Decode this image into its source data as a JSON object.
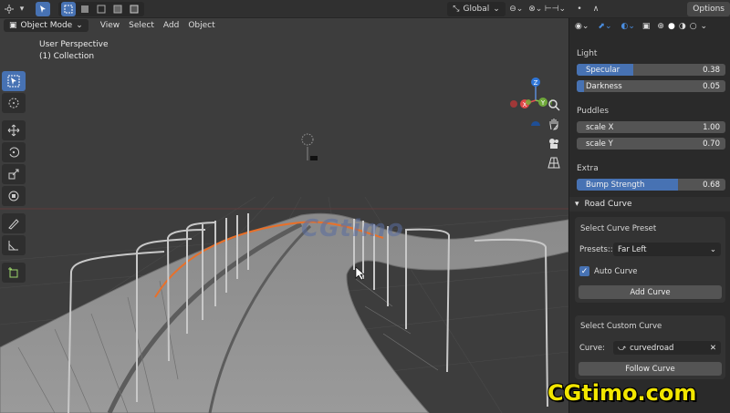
{
  "topbar": {
    "orientation": "Global",
    "options_label": "Options"
  },
  "header": {
    "mode": "Object Mode",
    "menus": [
      "View",
      "Select",
      "Add",
      "Object"
    ]
  },
  "viewport": {
    "view_name": "User Perspective",
    "collection": "(1) Collection",
    "logo_text": "CGtimo",
    "gizmo": {
      "z": "Z",
      "y": "Y",
      "x": "X"
    }
  },
  "panel": {
    "light": {
      "title": "Light",
      "specular_label": "Specular",
      "specular_value": "0.38",
      "specular": 0.38,
      "darkness_label": "Darkness",
      "darkness_value": "0.05",
      "darkness": 0.05
    },
    "puddles": {
      "title": "Puddles",
      "scalex_label": "scale X",
      "scalex_value": "1.00",
      "scaley_label": "scale Y",
      "scaley_value": "0.70"
    },
    "extra": {
      "title": "Extra",
      "bump_label": "Bump Strength",
      "bump_value": "0.68",
      "bump": 0.68
    },
    "road_curve": {
      "title": "Road Curve",
      "preset_title": "Select Curve Preset",
      "presets_label": "Presets::",
      "presets_value": "Far Left",
      "auto_curve_label": "Auto Curve",
      "add_curve_label": "Add Curve",
      "custom_title": "Select Custom Curve",
      "curve_label": "Curve:",
      "curve_value": "curvedroad",
      "follow_curve_label": "Follow Curve"
    }
  },
  "watermark": "CGtimo.com",
  "colors": {
    "accent": "#4772b3",
    "panel": "#2a2a2a",
    "viewport": "#3d3d3d",
    "watermark": "#f2e600"
  }
}
